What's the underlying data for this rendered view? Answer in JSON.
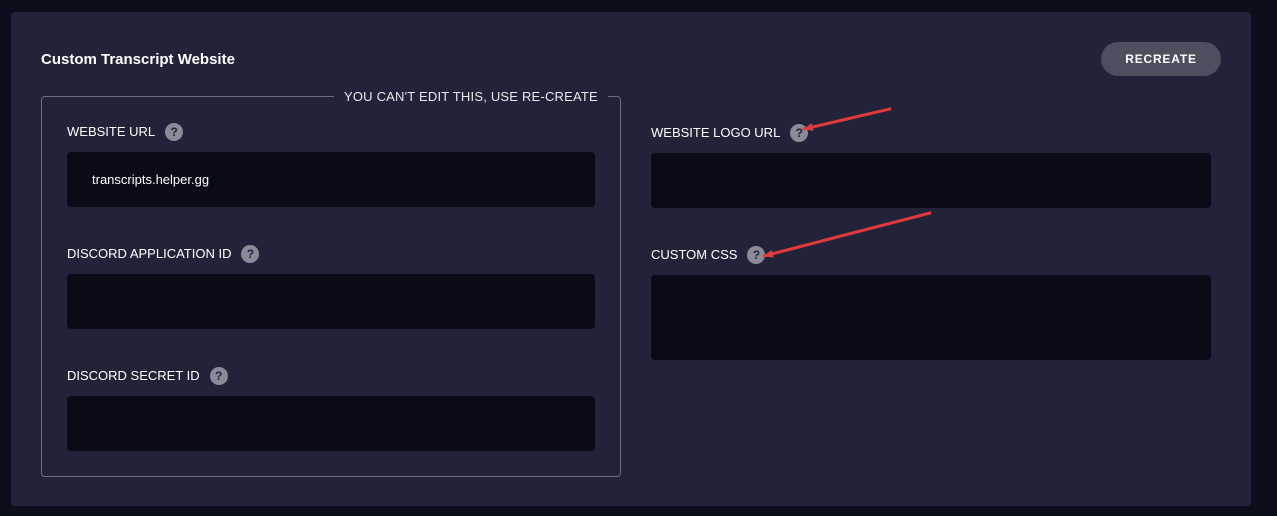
{
  "panel": {
    "title": "Custom Transcript Website",
    "recreate_label": "RECREATE"
  },
  "locked_group": {
    "legend": "YOU CAN'T EDIT THIS, USE RE-CREATE",
    "website_url": {
      "label": "WEBSITE URL",
      "value": "transcripts.helper.gg"
    },
    "discord_application_id": {
      "label": "DISCORD APPLICATION ID",
      "value": ""
    },
    "discord_secret_id": {
      "label": "DISCORD SECRET ID",
      "value": ""
    }
  },
  "website_logo_url": {
    "label": "WEBSITE LOGO URL",
    "value": ""
  },
  "custom_css": {
    "label": "CUSTOM CSS",
    "value": ""
  },
  "help_icon_glyph": "?",
  "icons": {
    "help": "question-circle-icon",
    "annotation": "red-arrow"
  },
  "colors": {
    "page_bg": "#0d0e1b",
    "panel_bg": "#222339",
    "input_bg": "#0a0b17",
    "button_bg": "#4d4e5e",
    "annotation_arrow": "#e03a3a"
  }
}
